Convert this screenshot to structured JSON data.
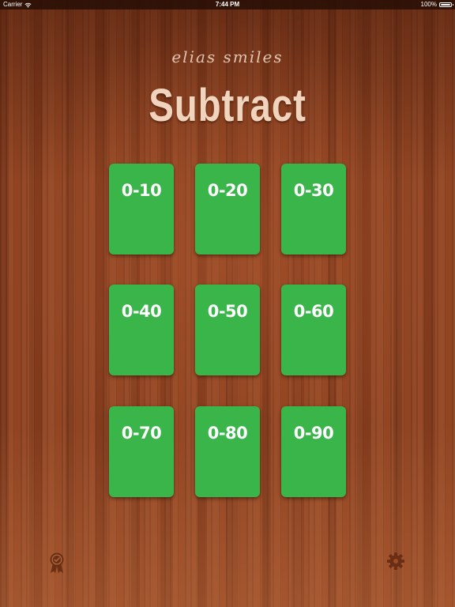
{
  "status_bar": {
    "carrier": "Carrier",
    "time": "7:44 PM",
    "battery": "100%"
  },
  "header": {
    "brand": "elias smiles",
    "title": "Subtract"
  },
  "cards": [
    {
      "label": "0-10"
    },
    {
      "label": "0-20"
    },
    {
      "label": "0-30"
    },
    {
      "label": "0-40"
    },
    {
      "label": "0-50"
    },
    {
      "label": "0-60"
    },
    {
      "label": "0-70"
    },
    {
      "label": "0-80"
    },
    {
      "label": "0-90"
    }
  ],
  "icons": {
    "awards": "award-ribbon-icon",
    "settings": "gear-icon"
  },
  "colors": {
    "card": "#3ab54a",
    "title": "#f1d4bd",
    "icon": "#6a2e14"
  }
}
